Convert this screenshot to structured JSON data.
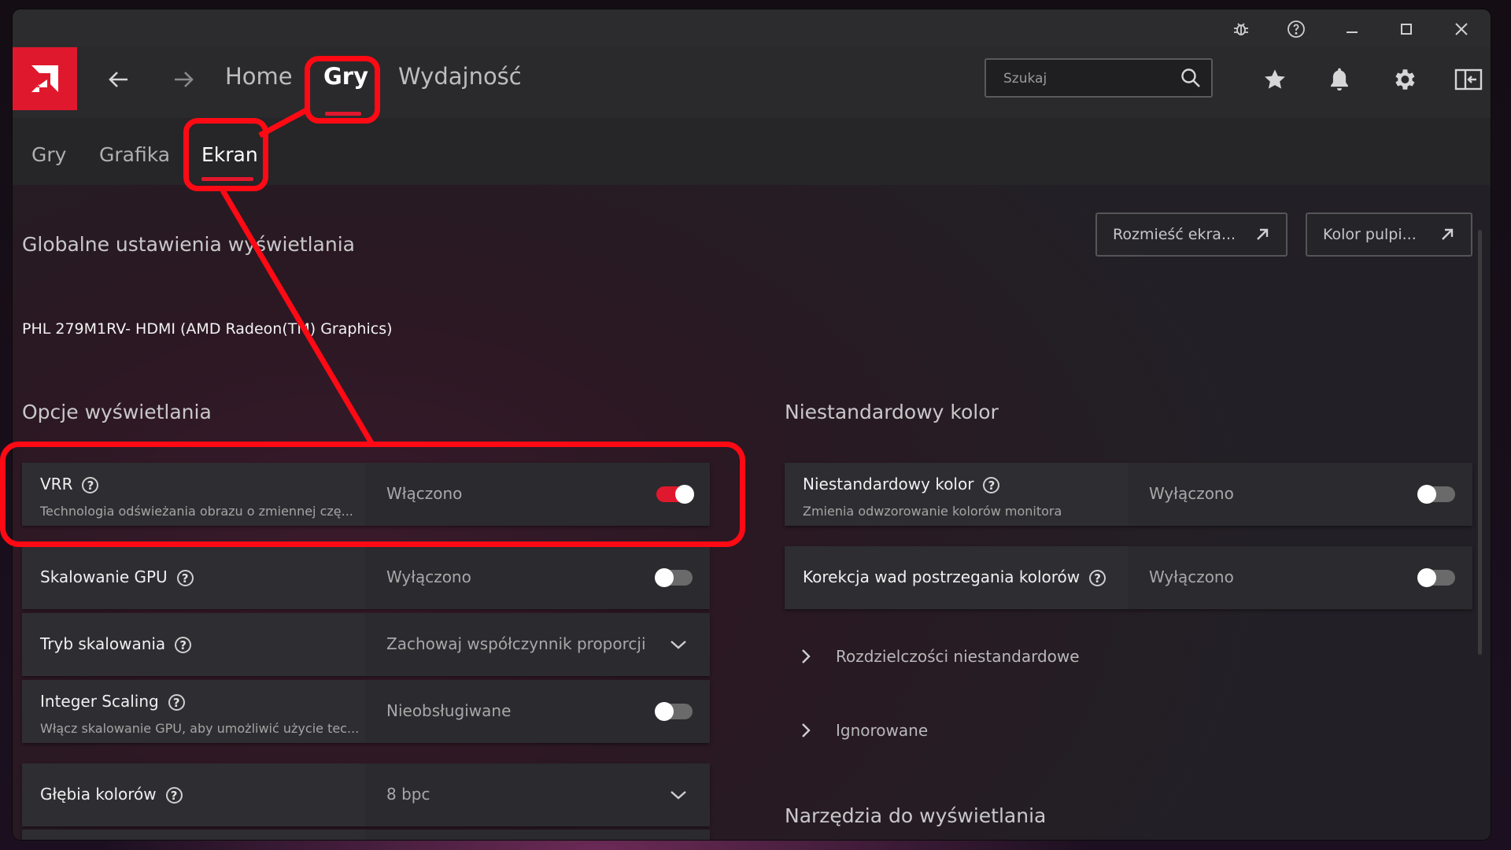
{
  "titlebar": {
    "icons": [
      "bug-icon",
      "help-circle-icon",
      "minimize-icon",
      "maximize-icon",
      "close-icon"
    ]
  },
  "nav": {
    "back_icon": "arrow-left-icon",
    "forward_icon": "arrow-right-icon",
    "tabs": [
      {
        "label": "Home"
      },
      {
        "label": "Gry"
      },
      {
        "label": "Wydajność"
      }
    ],
    "active_tab": "Gry",
    "search": {
      "placeholder": "Szukaj",
      "value": ""
    },
    "right_icons": [
      "star-icon",
      "bell-icon",
      "gear-icon",
      "sidebar-icon"
    ]
  },
  "subnav": {
    "tabs": [
      {
        "label": "Gry"
      },
      {
        "label": "Grafika"
      },
      {
        "label": "Ekran"
      }
    ],
    "active_tab": "Ekran"
  },
  "content": {
    "global_heading": "Globalne ustawienia wyświetlania",
    "monitor_name": "PHL 279M1RV- HDMI (AMD Radeon(TM) Graphics)",
    "link_buttons": [
      {
        "label": "Rozmieść ekra..."
      },
      {
        "label": "Kolor pulpi..."
      }
    ],
    "display_options": {
      "heading": "Opcje wyświetlania",
      "rows": [
        {
          "title": "VRR",
          "subtitle": "Technologia odświeżania obrazu o zmiennej czę...",
          "value": "Włączono",
          "control": "toggle",
          "state": "on"
        },
        {
          "title": "Skalowanie GPU",
          "subtitle": "",
          "value": "Wyłączono",
          "control": "toggle",
          "state": "off"
        },
        {
          "title": "Tryb skalowania",
          "subtitle": "",
          "value": "Zachowaj współczynnik proporcji",
          "control": "dropdown"
        },
        {
          "title": "Integer Scaling",
          "subtitle": "Włącz skalowanie GPU, aby umożliwić użycie tec...",
          "value": "Nieobsługiwane",
          "control": "toggle",
          "state": "off"
        },
        {
          "title": "Głębia kolorów",
          "subtitle": "",
          "value": "8 bpc",
          "control": "dropdown"
        }
      ]
    },
    "custom_color": {
      "heading": "Niestandardowy kolor",
      "rows": [
        {
          "title": "Niestandardowy kolor",
          "subtitle": "Zmienia odwzorowanie kolorów monitora",
          "value": "Wyłączono",
          "control": "toggle",
          "state": "off"
        },
        {
          "title": "Korekcja wad postrzegania kolorów",
          "subtitle": "",
          "value": "Wyłączono",
          "control": "toggle",
          "state": "off"
        }
      ],
      "expanders": [
        {
          "label": "Rozdzielczości niestandardowe"
        },
        {
          "label": "Ignorowane"
        }
      ]
    },
    "tools_heading": "Narzędzia do wyświetlania"
  },
  "colors": {
    "accent": "#e0182d",
    "annotation": "#ff0a14",
    "toggle_off": "#6a6a6a"
  }
}
